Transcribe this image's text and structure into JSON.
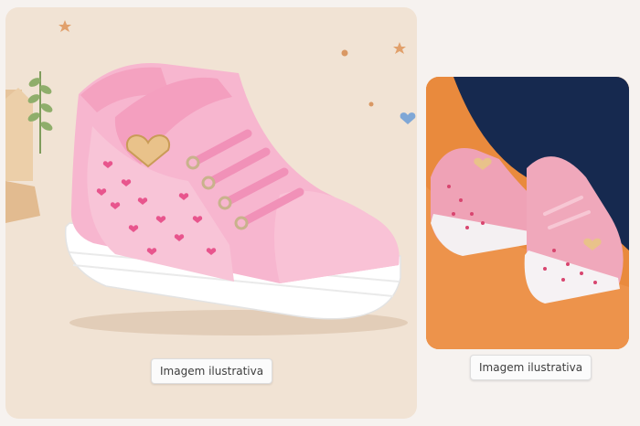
{
  "left_card": {
    "caption": "Imagem ilustrativa",
    "product": "pink-high-top-sneaker",
    "colors": {
      "background": "#f1e3d4",
      "shoe": "#f7b6cf",
      "sole": "#ffffff",
      "accent": "#e8558d"
    }
  },
  "right_card": {
    "caption": "Imagem ilustrativa",
    "product": "pink-sneakers-photo",
    "colors": {
      "background": "#e98a3d",
      "fabric": "#16294f",
      "shoe": "#efa2b6"
    }
  }
}
